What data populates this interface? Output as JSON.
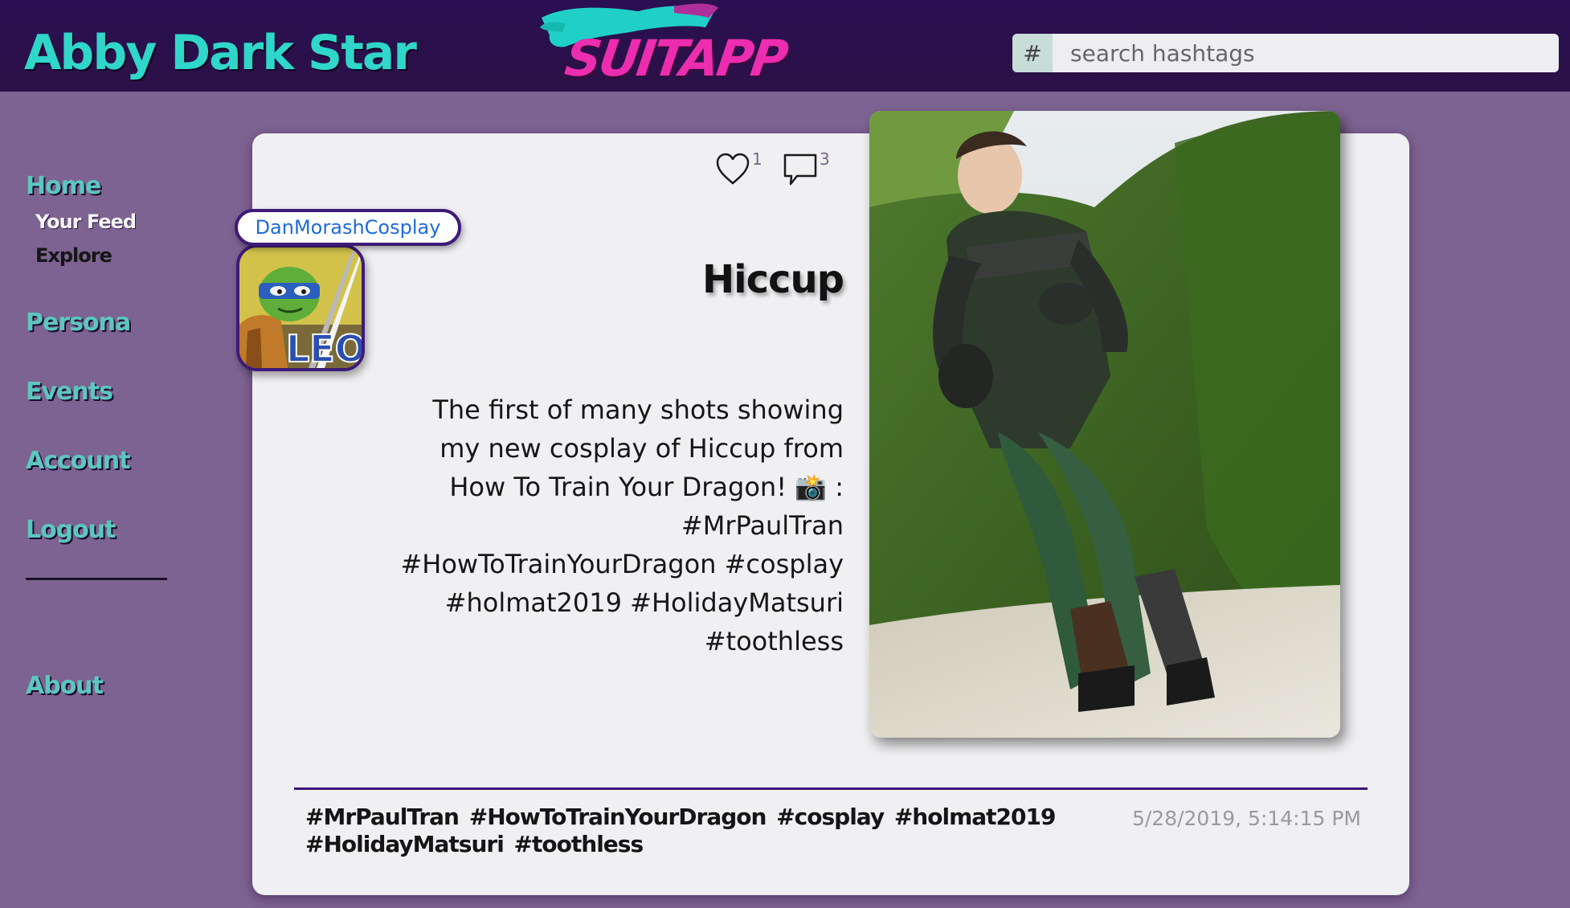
{
  "header": {
    "user_name": "Abby Dark Star",
    "logo_text": "SUITAPP",
    "search": {
      "prefix_symbol": "#",
      "placeholder": "search hashtags",
      "value": ""
    }
  },
  "sidebar": {
    "home": "Home",
    "your_feed": "Your Feed",
    "explore": "Explore",
    "persona": "Persona",
    "events": "Events",
    "account": "Account",
    "logout": "Logout",
    "about": "About"
  },
  "post": {
    "likes": "1",
    "comments": "3",
    "author": "DanMorashCosplay",
    "avatar_text": "LEO",
    "title": "Hiccup",
    "body": "The first of many shots showing my new cosplay of Hiccup from How To Train Your Dragon! 📸 : #MrPaulTran #HowToTrainYourDragon #cosplay #holmat2019 #HolidayMatsuri #toothless",
    "tags": "#MrPaulTran #HowToTrainYourDragon #cosplay #holmat2019 #HolidayMatsuri #toothless",
    "timestamp": "5/28/2019, 5:14:15 PM"
  },
  "icons": {
    "like": "heart-icon",
    "comment": "speech-bubble-icon",
    "search_prefix": "hash-icon"
  },
  "colors": {
    "header_bg": "#2a0f53",
    "page_bg": "#7d6391",
    "accent_teal": "#2fd6c9",
    "logo_pink": "#ec2db0",
    "card_bg": "#f0eff1",
    "border_purple": "#3e1a78",
    "link_blue": "#1e6ad8"
  }
}
